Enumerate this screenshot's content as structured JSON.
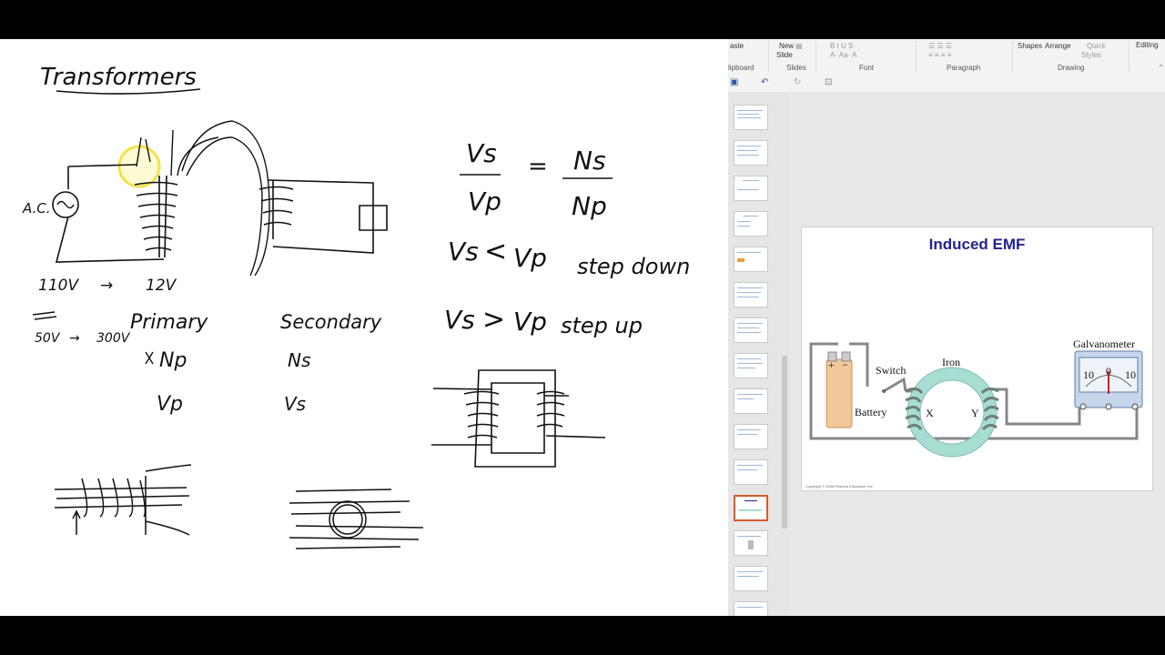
{
  "whiteboard": {
    "title": "Transformers",
    "ac_label": "A.C.",
    "voltage_1_in": "110V",
    "voltage_1_out": "12V",
    "arrow": "→",
    "voltage_2_in": "50V",
    "voltage_2_out": "300V",
    "primary": "Primary",
    "secondary": "Secondary",
    "np": "Np",
    "ns": "Ns",
    "vp": "Vp",
    "vs": "Vs",
    "eq_vs": "Vs",
    "eq_vp": "Vp",
    "eq_ns": "Ns",
    "eq_np": "Np",
    "eq_sign": "=",
    "rel_1_left": "Vs",
    "rel_1_op": "<",
    "rel_1_right": "Vp",
    "rel_1_label": "step down",
    "rel_2_left": "Vs",
    "rel_2_op": ">",
    "rel_2_right": "Vp",
    "rel_2_label": "step up"
  },
  "ribbon": {
    "paste": "aste",
    "new_slide_1": "New",
    "new_slide_2": "Slide",
    "shapes": "Shapes",
    "arrange": "Arrange",
    "quick_styles_1": "Quick",
    "quick_styles_2": "Styles",
    "editing": "Editing",
    "groups": {
      "clipboard": "lipboard",
      "slides": "Slides",
      "font": "Font",
      "paragraph": "Paragraph",
      "drawing": "Drawing"
    }
  },
  "slide": {
    "title": "Induced EMF",
    "labels": {
      "battery": "Battery",
      "switch": "Switch",
      "iron": "Iron",
      "x": "X",
      "y": "Y",
      "galvanometer": "Galvanometer",
      "plus": "+",
      "minus": "−",
      "scale_left": "10",
      "scale_zero": "0",
      "scale_right": "10"
    },
    "copyright": "Copyright © 2008 Pearson Education, Inc."
  },
  "thumbnails": {
    "count": 15,
    "selected_index": 11
  },
  "colors": {
    "title_color": "#23238e",
    "selected_thumb": "#d55a2a",
    "highlighter": "#f2e24a",
    "toroid": "#a7ddd2"
  }
}
